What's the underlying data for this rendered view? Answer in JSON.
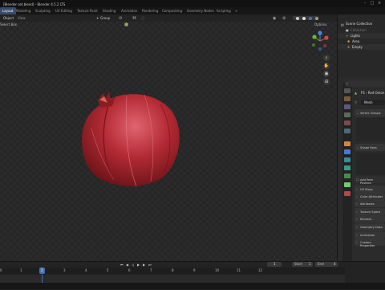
{
  "window": {
    "title": "[Blender set.blend] - Blender 4.5.2 LTS",
    "controls": [
      "–",
      "□",
      "×"
    ]
  },
  "tabs": [
    "Layout",
    "Modeling",
    "Sculpting",
    "UV Editing",
    "Texture Paint",
    "Shading",
    "Animation",
    "Rendering",
    "Compositing",
    "Geometry Nodes",
    "Scripting"
  ],
  "tab_add": "+",
  "viewport": {
    "mode": "Object",
    "menu_view": "View",
    "select_box": "Select Box",
    "transform": "Group",
    "options": "Options",
    "nav_icons": [
      "zoom-icon",
      "hand-icon",
      "camera-icon",
      "grid-icon"
    ]
  },
  "outliner": {
    "title": "Scene Collection",
    "items": [
      {
        "label": "Collection",
        "icon": "collection-icon"
      },
      {
        "label": "Lights",
        "icon": "light-icon"
      },
      {
        "label": "Area",
        "icon": "light-icon"
      },
      {
        "label": "Empty",
        "icon": "empty-icon"
      }
    ]
  },
  "properties": {
    "object_name": "FS - Red Onion",
    "data_name": "Mesh",
    "panels": [
      "Vertex Groups",
      "Shape Keys",
      "Add Rest Position",
      "UV Maps",
      "Color Attributes",
      "Attributes",
      "Texture Space",
      "Remesh",
      "Geometry Data",
      "Animation",
      "Custom Properties"
    ]
  },
  "timeline": {
    "frames": [
      "0",
      "1",
      "2",
      "3",
      "4",
      "5",
      "6",
      "7",
      "8",
      "9",
      "10",
      "11",
      "12"
    ],
    "current_frame": "1",
    "start_label": "Start",
    "start": "1",
    "end_label": "End",
    "end": "4",
    "frame_box": "1"
  },
  "colors": {
    "accent": "#4772b3",
    "onion": "#a02228"
  }
}
